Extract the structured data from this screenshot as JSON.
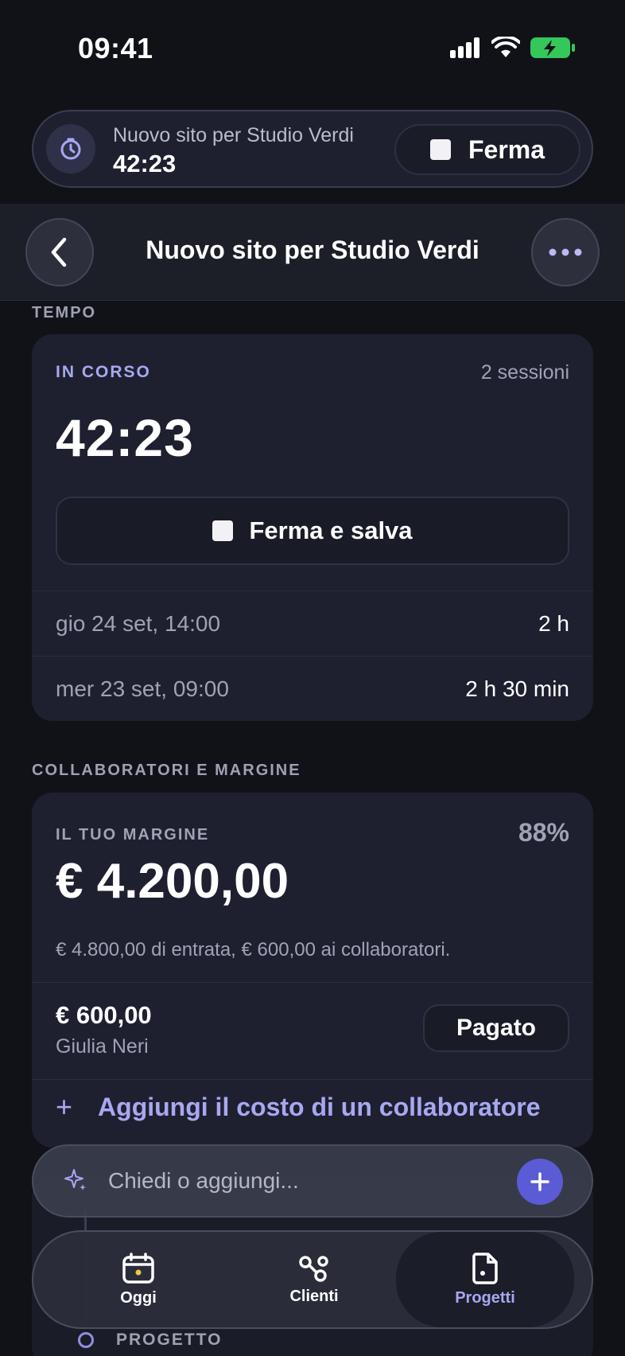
{
  "status_bar": {
    "time": "09:41"
  },
  "live_activity": {
    "title": "Nuovo sito per Studio Verdi",
    "elapsed": "42:23",
    "stop_label": "Ferma",
    "timer_icon": "timer-icon"
  },
  "nav": {
    "title": "Nuovo sito per Studio Verdi",
    "back_icon": "chevron-left-icon",
    "more_icon": "ellipsis-icon"
  },
  "time_section": {
    "label": "TEMPO",
    "status": "IN CORSO",
    "sessions_count": "2 sessioni",
    "elapsed": "42:23",
    "stop_save_label": "Ferma e salva",
    "sessions": [
      {
        "date": "gio 24 set, 14:00",
        "duration": "2 h"
      },
      {
        "date": "mer 23 set, 09:00",
        "duration": "2 h 30 min"
      }
    ]
  },
  "margin_section": {
    "label": "COLLABORATORI E MARGINE",
    "margin_label": "IL TUO MARGINE",
    "margin_percent": "88%",
    "margin_value": "€ 4.200,00",
    "description": "€ 4.800,00 di entrata, € 600,00 ai collaboratori.",
    "collaborator": {
      "amount": "€ 600,00",
      "name": "Giulia Neri",
      "status": "Pagato"
    },
    "add_label": "Aggiungi il costo di un collaboratore",
    "add_icon": "plus-icon"
  },
  "behind": {
    "progetto_label": "PROGETTO"
  },
  "ask_bar": {
    "placeholder": "Chiedi o aggiungi...",
    "spark_icon": "sparkle-icon",
    "plus_icon": "plus-icon"
  },
  "tabs": [
    {
      "label": "Oggi",
      "icon": "calendar-icon",
      "active": false
    },
    {
      "label": "Clienti",
      "icon": "graph-nodes-icon",
      "active": false
    },
    {
      "label": "Progetti",
      "icon": "document-icon",
      "active": true
    }
  ],
  "colors": {
    "accent": "#a7a8f0",
    "accent_button": "#5b5bd6",
    "background": "#111218",
    "card": "#1e2030",
    "battery": "#34c759"
  }
}
